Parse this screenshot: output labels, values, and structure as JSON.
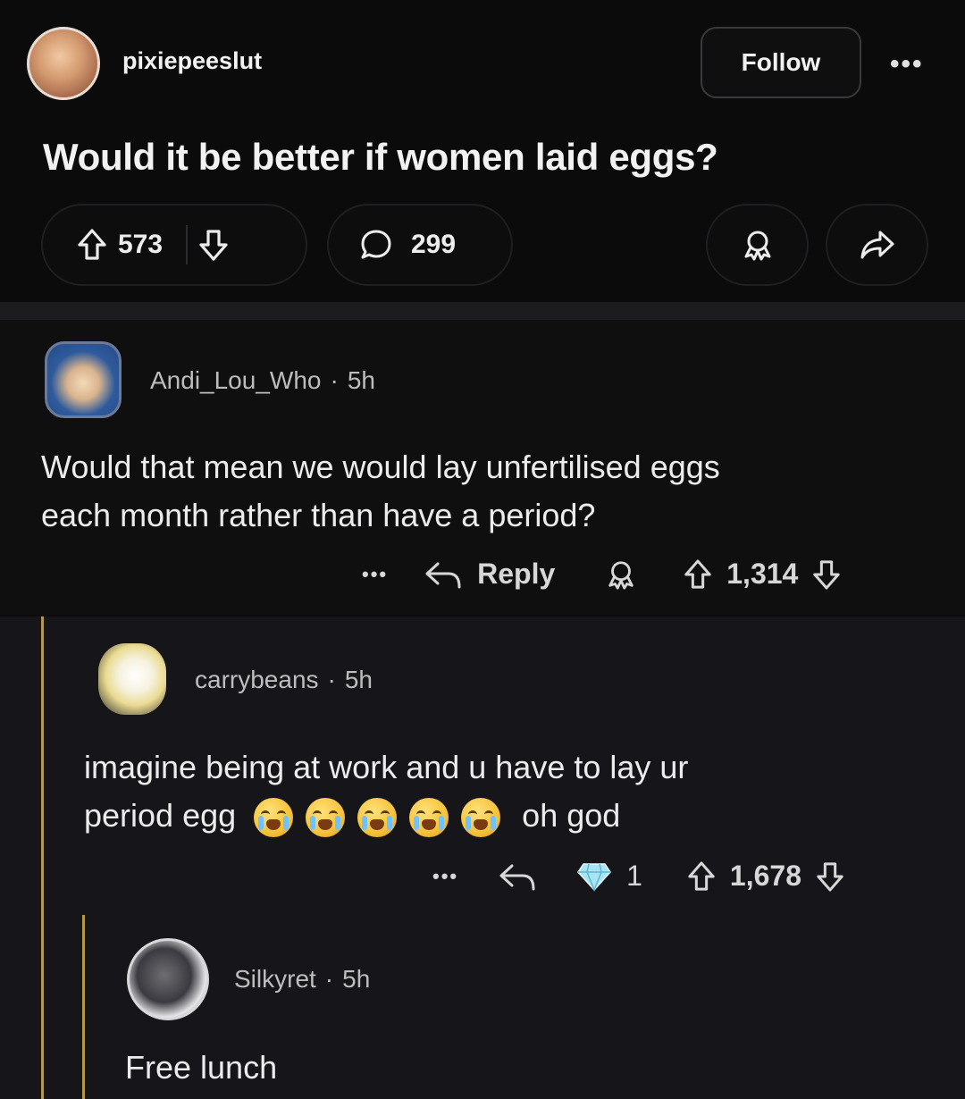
{
  "post": {
    "username": "pixiepeeslut",
    "follow_label": "Follow",
    "more_label": "•••",
    "title": "Would it be better if women laid eggs?",
    "upvotes": "573",
    "comments": "299"
  },
  "comments": [
    {
      "username": "Andi_Lou_Who",
      "sep": "·",
      "age": "5h",
      "body_line1": "Would that mean we would lay unfertilised eggs",
      "body_line2": "each month rather than have a period?",
      "more_label": "•••",
      "reply_label": "Reply",
      "score": "1,314"
    },
    {
      "username": "carrybeans",
      "sep": "·",
      "age": "5h",
      "body_line1": "imagine being at work and u have to lay ur",
      "body_line2_start": "period egg",
      "body_line2_end": "oh god",
      "emoji_count": 5,
      "more_label": "•••",
      "award_count": "1",
      "score": "1,678"
    },
    {
      "username": "Silkyret",
      "sep": "·",
      "age": "5h",
      "body": "Free lunch"
    }
  ],
  "colors": {
    "background": "#0b0b0c",
    "comment_bg": "#0f0f10",
    "reply_bg": "#16161a",
    "thread_line": "#b39a4a",
    "text": "#ececec"
  },
  "icons": [
    "upvote-icon",
    "downvote-icon",
    "comment-bubble-icon",
    "award-icon",
    "share-icon",
    "reply-arrow-icon",
    "diamond-award-icon",
    "crying-emoji-icon"
  ]
}
